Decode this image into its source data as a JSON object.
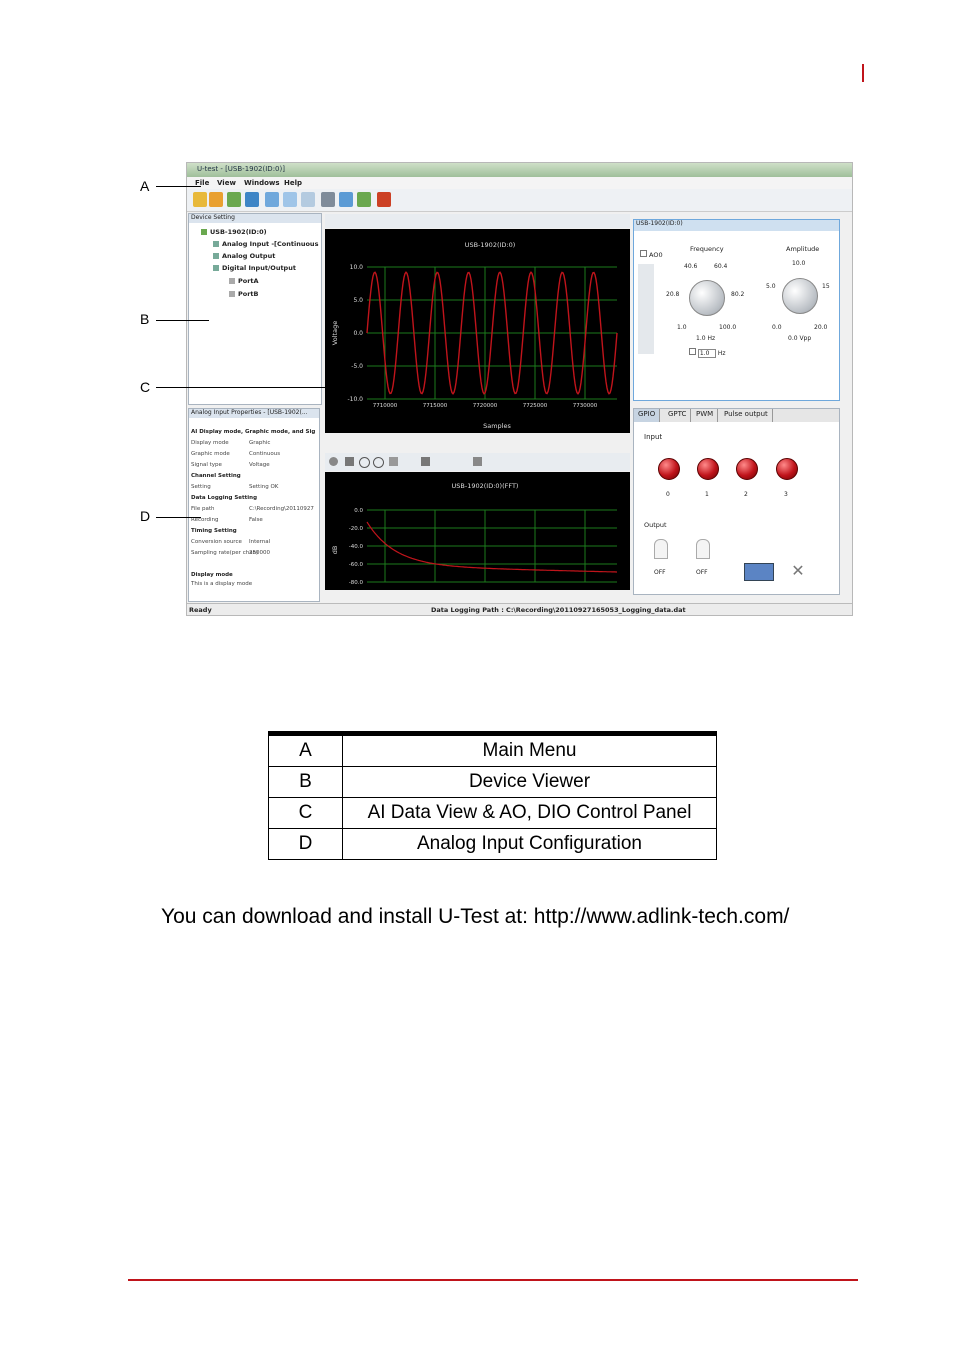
{
  "figure": {
    "window_title": "U-test - [USB-1902(ID:0)]",
    "menu": [
      "File",
      "View",
      "Windows",
      "Help"
    ],
    "device_panel": {
      "title": "Device Setting",
      "tree": [
        "USB-1902(ID:0)",
        "Analog Input -[Continuous",
        "Analog Output",
        "Digital Input/Output",
        "PortA",
        "PortB"
      ]
    },
    "properties_panel": {
      "title": "Analog Input Properties - [USB-1902(...",
      "rows": [
        {
          "name": "AI Display mode, Graphic mode, and Sig",
          "value": "",
          "header": true
        },
        {
          "name": "Display mode",
          "value": "Graphic",
          "header": false
        },
        {
          "name": "Graphic mode",
          "value": "Continuous",
          "header": false
        },
        {
          "name": "Signal type",
          "value": "Voltage",
          "header": false
        },
        {
          "name": "Channel Setting",
          "value": "",
          "header": true
        },
        {
          "name": "Setting",
          "value": "Setting OK",
          "header": false
        },
        {
          "name": "Data Logging Setting",
          "value": "",
          "header": true
        },
        {
          "name": "File path",
          "value": "C:\\Recording\\20110927",
          "header": false
        },
        {
          "name": "Recording",
          "value": "False",
          "header": false
        },
        {
          "name": "Timing Setting",
          "value": "",
          "header": true
        },
        {
          "name": "Conversion source",
          "value": "Internal",
          "header": false
        },
        {
          "name": "Sampling rate(per chan)",
          "value": "250000",
          "header": false
        }
      ],
      "help_title": "Display mode",
      "help_text": "This is a display mode"
    },
    "time_plot": {
      "title": "USB-1902(ID:0)",
      "ylabel": "Voltage",
      "xlabel": "Samples",
      "yticks": [
        "10.0",
        "5.0",
        "0.0",
        "-5.0",
        "-10.0"
      ],
      "xticks": [
        "7710000",
        "7715000",
        "7720000",
        "7725000",
        "7730000"
      ]
    },
    "fft_plot": {
      "title": "USB-1902(ID:0)(FFT)",
      "ylabel": "dB",
      "yticks": [
        "0.0",
        "-20.0",
        "-40.0",
        "-60.0",
        "-80.0"
      ]
    },
    "ao_panel": {
      "title": "USB-1902(ID:0)",
      "channel": "AO0",
      "frequency_label": "Frequency",
      "frequency_ticks": [
        "40.6",
        "60.4",
        "20.8",
        "80.2",
        "1.0",
        "100.0"
      ],
      "frequency_value": "1.0 Hz",
      "frequency_input": "1.0",
      "frequency_unit": "Hz",
      "amplitude_label": "Amplitude",
      "amplitude_ticks": [
        "10.0",
        "5.0",
        "15",
        "0.0",
        "20.0"
      ],
      "amplitude_value": "0.0 Vpp"
    },
    "dio_panel": {
      "tabs": [
        "GPIO",
        "GPTC",
        "PWM",
        "Pulse output"
      ],
      "input_label": "Input",
      "input_channels": [
        "0",
        "1",
        "2",
        "3"
      ],
      "output_label": "Output",
      "output_states": [
        "OFF",
        "OFF"
      ]
    },
    "status": {
      "ready": "Ready",
      "path": "Data Logging Path : C:\\Recording\\20110927165053_Logging_data.dat"
    }
  },
  "callouts": [
    "A",
    "B",
    "C",
    "D"
  ],
  "legend": [
    {
      "key": "A",
      "desc": "Main Menu"
    },
    {
      "key": "B",
      "desc": "Device Viewer"
    },
    {
      "key": "C",
      "desc": "AI Data View & AO, DIO Control Panel"
    },
    {
      "key": "D",
      "desc": "Analog Input Configuration"
    }
  ],
  "paragraph": "You can download and install U-Test at: http://www.adlink-tech.com/",
  "colors": {
    "accent": "#c0141b",
    "signal": "#c0141b",
    "grid": "#1c7a1c"
  }
}
